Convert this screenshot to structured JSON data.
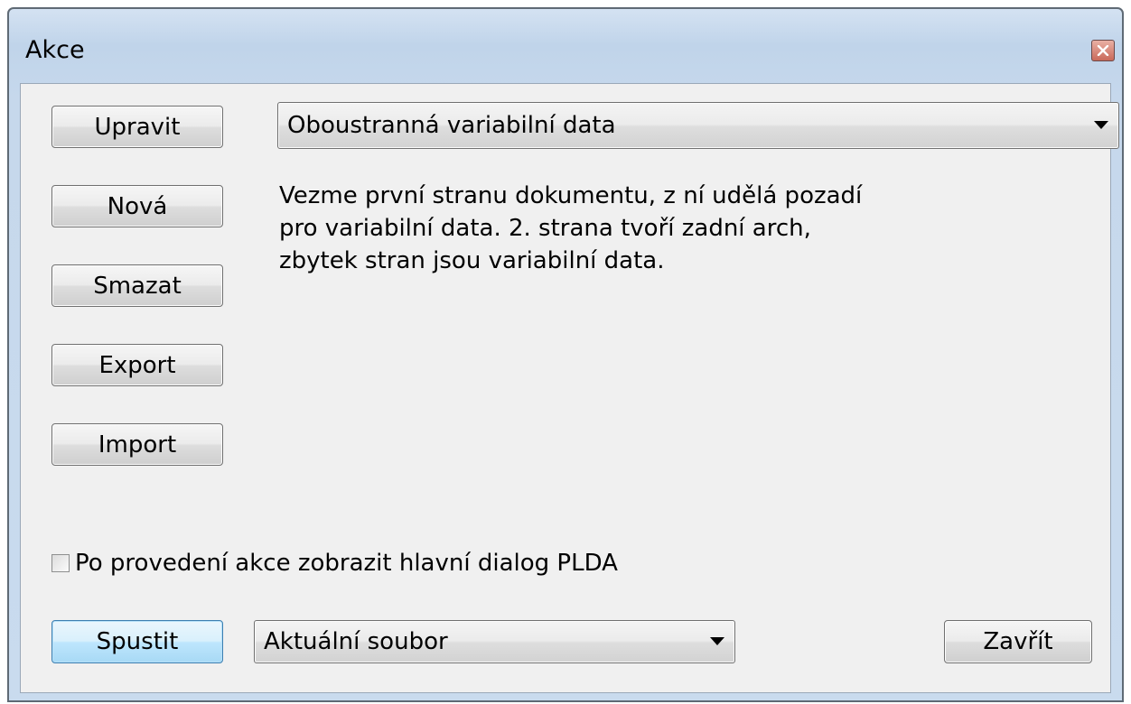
{
  "window": {
    "title": "Akce"
  },
  "side_buttons": [
    {
      "label": "Upravit"
    },
    {
      "label": "Nová"
    },
    {
      "label": "Smazat"
    },
    {
      "label": "Export"
    },
    {
      "label": "Import"
    }
  ],
  "action_select": {
    "value": "Oboustranná variabilní data"
  },
  "description": "Vezme první stranu dokumentu, z ní udělá pozadí\npro variabilní data. 2. strana tvoří zadní arch,\nzbytek stran jsou variabilní data.",
  "checkbox": {
    "label": "Po provedení akce zobrazit hlavní dialog PLDA",
    "checked": false
  },
  "footer": {
    "run_label": "Spustit",
    "target_select_value": "Aktuální soubor",
    "close_label": "Zavřít"
  },
  "icons": {
    "close": "close-icon",
    "dropdown": "chevron-down-icon"
  }
}
